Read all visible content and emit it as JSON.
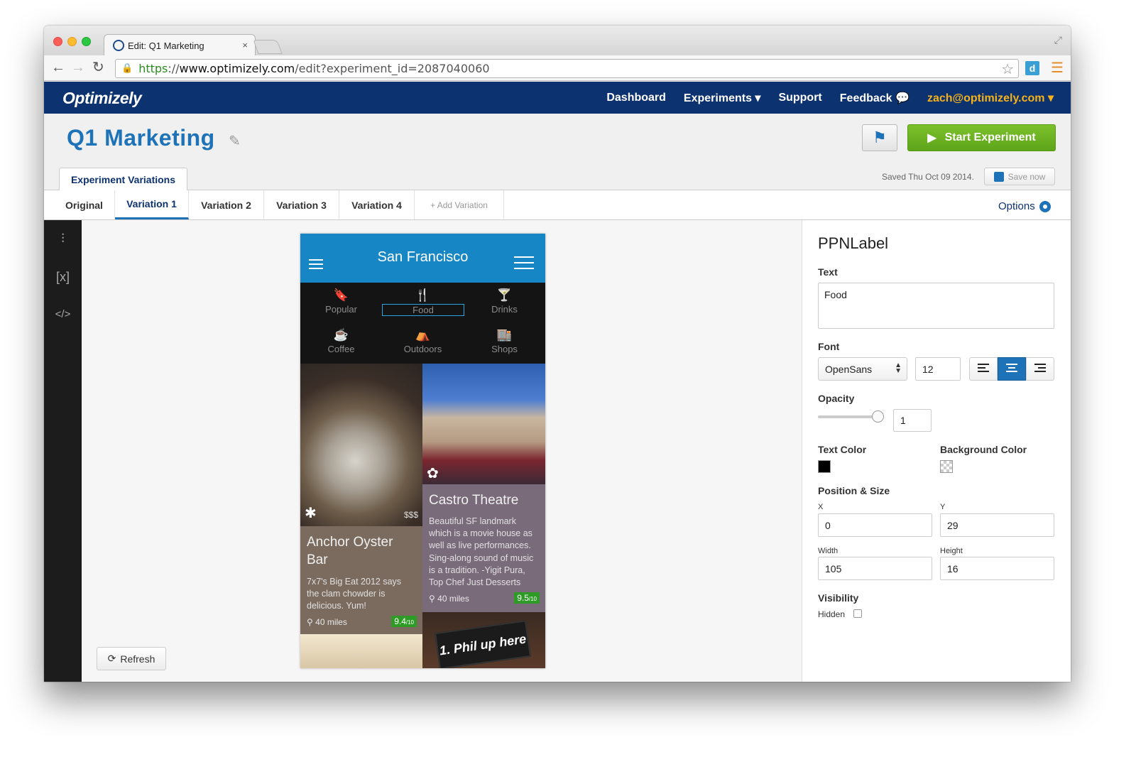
{
  "browser": {
    "tab_title": "Edit: Q1 Marketing",
    "tab_close": "×",
    "url_scheme": "https",
    "url_sep": "://",
    "url_host": "www.optimizely.com",
    "url_path": "/edit?experiment_id=2087040060",
    "ext_label": "d"
  },
  "topnav": {
    "logo": "Optimizely",
    "links": [
      "Dashboard",
      "Experiments ▾",
      "Support",
      "Feedback 💬"
    ],
    "user": "zach@optimizely.com ▾"
  },
  "header": {
    "title": "Q1 Marketing",
    "start_label": "Start Experiment",
    "variations_tab": "Experiment Variations",
    "saved": "Saved Thu Oct 09 2014.",
    "save_now": "Save now"
  },
  "variation_tabs": [
    "Original",
    "Variation 1",
    "Variation 2",
    "Variation 3",
    "Variation 4",
    "+ Add Variation"
  ],
  "active_tab": "Variation 1",
  "options_label": "Options",
  "refresh_label": "Refresh",
  "phone": {
    "city": "San Francisco",
    "categories": [
      "Popular",
      "Food",
      "Drinks",
      "Coffee",
      "Outdoors",
      "Shops"
    ],
    "selected_category": "Food",
    "tile1": {
      "price": "$$$",
      "title_line1": "Anchor Oyster",
      "title_line2": "Bar",
      "desc": [
        "7x7's Big Eat 2012 says",
        "the clam chowder is",
        "delicious. Yum!"
      ],
      "miles": "40 miles",
      "score": "9.4",
      "score_max": "/10"
    },
    "tile2": {
      "title": "Castro Theatre",
      "desc": [
        "Beautiful SF landmark",
        "which is a movie house as",
        "well as live performances.",
        "Sing-along sound of music",
        "is a tradition. -Yigit Pura,",
        "Top Chef Just Desserts"
      ],
      "miles": "40 miles",
      "score": "9.5",
      "score_max": "/10"
    },
    "sign_text": "1. Phil up here"
  },
  "panel": {
    "title": "PPNLabel",
    "text_label": "Text",
    "text_value": "Food",
    "font_label": "Font",
    "font_family": "OpenSans",
    "font_size": "12",
    "opacity_label": "Opacity",
    "opacity": "1",
    "text_color_label": "Text Color",
    "bg_color_label": "Background Color",
    "text_color": "#000000",
    "position_label": "Position & Size",
    "x_label": "X",
    "x": "0",
    "y_label": "Y",
    "y": "29",
    "width_label": "Width",
    "width": "105",
    "height_label": "Height",
    "height": "16",
    "visibility_label": "Visibility",
    "hidden_label": "Hidden"
  },
  "colors": {
    "nav_bg": "#0d3270",
    "accent": "#1d72b8",
    "start_green": "#6cb322",
    "phone_header": "#1686c5"
  }
}
